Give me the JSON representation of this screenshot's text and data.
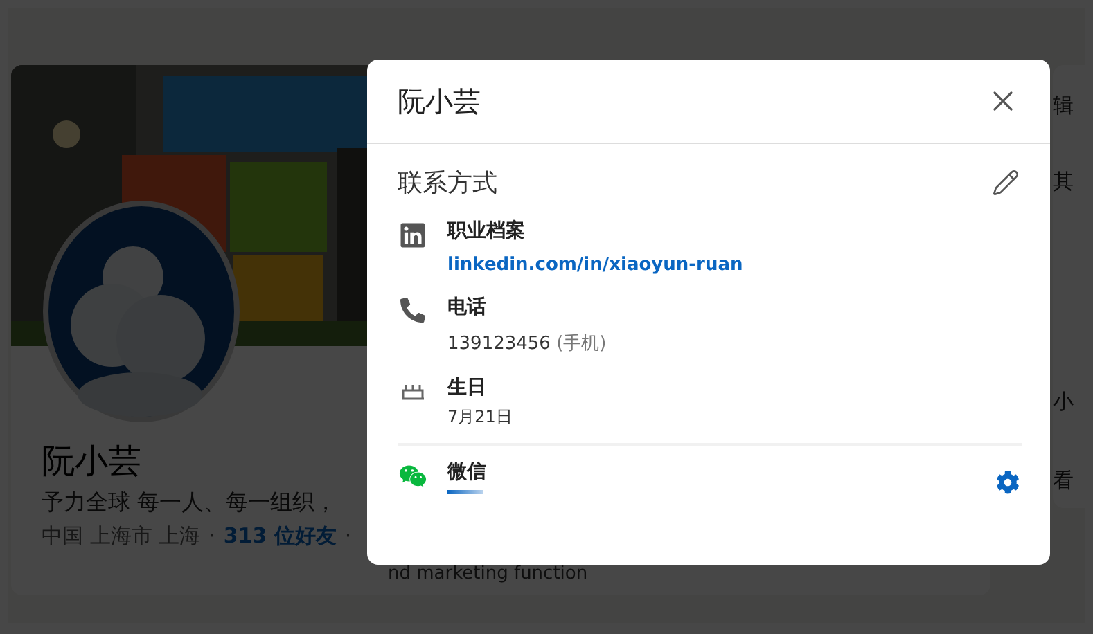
{
  "profile": {
    "name": "阮小芸",
    "headline": "予力全球 每一人、每一组织，",
    "location": "中国 上海市 上海",
    "connections": "313 位好友",
    "separators": [
      "·",
      "·"
    ],
    "about_fragment": "nd marketing function"
  },
  "sidebar_fragments": [
    "辑",
    "其",
    "小",
    "看"
  ],
  "dialog": {
    "title": "阮小芸",
    "section_title": "联系方式",
    "items": [
      {
        "kind": "linkedin",
        "label": "职业档案",
        "link": "linkedin.com/in/xiaoyun-ruan"
      },
      {
        "kind": "phone",
        "label": "电话",
        "value": "139123456",
        "note": "(手机)"
      },
      {
        "kind": "birthday",
        "label": "生日",
        "value": "7月21日"
      },
      {
        "kind": "wechat",
        "label": "微信"
      }
    ]
  }
}
